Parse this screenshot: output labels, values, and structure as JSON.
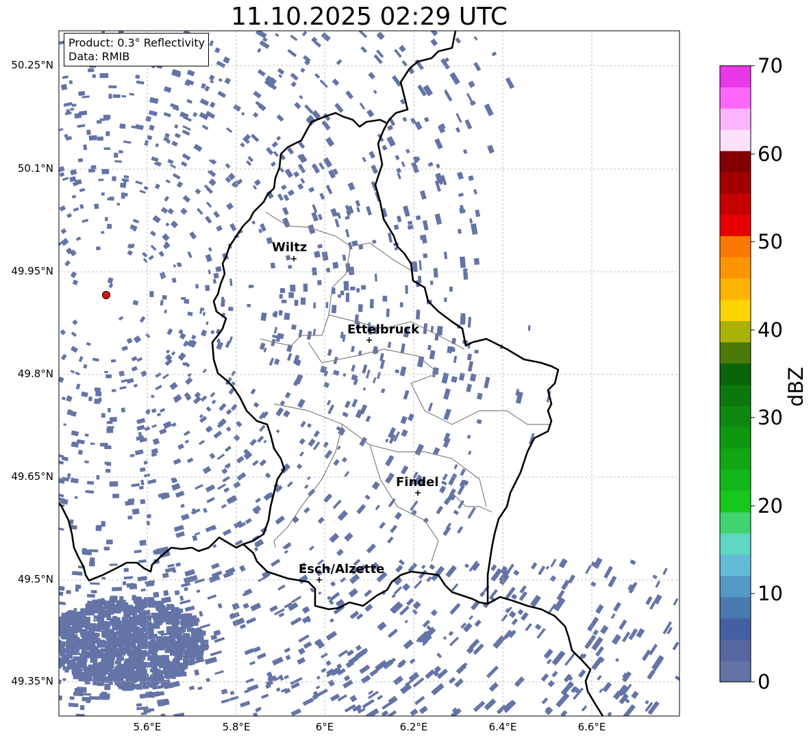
{
  "title": "11.10.2025 02:29 UTC",
  "info": {
    "product": "Product: 0.3° Reflectivity",
    "data": "Data: RMIB"
  },
  "lat_ticks": [
    "50.25°N",
    "50.1°N",
    "49.95°N",
    "49.8°N",
    "49.65°N",
    "49.5°N",
    "49.35°N"
  ],
  "lon_ticks": [
    "5.6°E",
    "5.8°E",
    "6°E",
    "6.2°E",
    "6.4°E",
    "6.6°E"
  ],
  "cities": [
    {
      "name": "Wiltz"
    },
    {
      "name": "Ettelbruck"
    },
    {
      "name": "Findel"
    },
    {
      "name": "Esch/Alzette"
    }
  ],
  "colorbar": {
    "label": "dBZ",
    "ticks": [
      "0",
      "10",
      "20",
      "30",
      "40",
      "50",
      "60",
      "70"
    ],
    "colors": [
      "#6472a6",
      "#5566a0",
      "#4560a2",
      "#4a7ab0",
      "#5498c4",
      "#62bcd8",
      "#5ed6c4",
      "#40d470",
      "#16c81c",
      "#12b81a",
      "#10a812",
      "#0e9810",
      "#0e880e",
      "#0c780c",
      "#0a640a",
      "#4a7a0a",
      "#aab208",
      "#fcd400",
      "#fcb400",
      "#fc9600",
      "#fc7800",
      "#e40000",
      "#c40000",
      "#a20000",
      "#820000",
      "#fce0fc",
      "#fcb4fc",
      "#fc68fc",
      "#e838e8"
    ]
  },
  "colors": {
    "echo": "#6474a6",
    "border": "#000000",
    "canton": "#808080",
    "grid": "#b0b0b0",
    "radar_site": "#dd1111"
  },
  "icons": {
    "radar_site": "radar-site-marker",
    "city": "city-cross-marker"
  }
}
